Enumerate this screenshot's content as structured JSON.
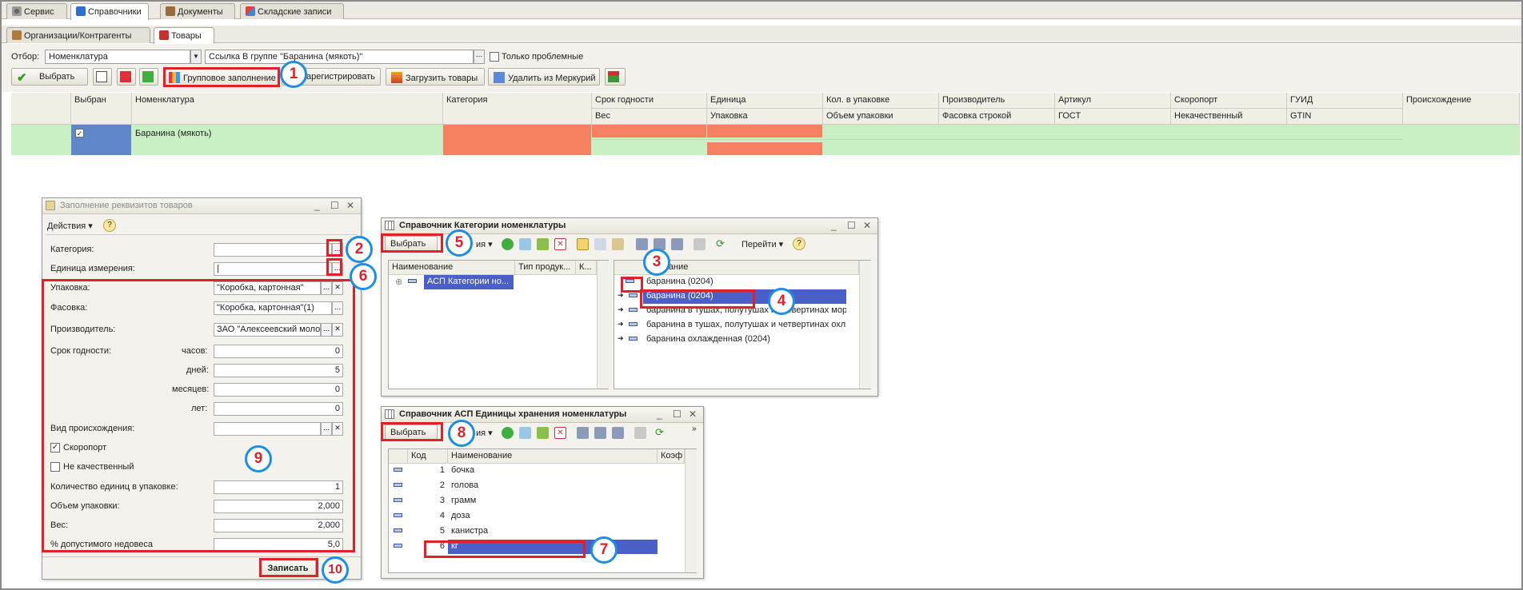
{
  "tabs_top": [
    "Сервис",
    "Справочники",
    "Документы",
    "Складские записи"
  ],
  "tabs_sub": [
    "Организации/Контрагенты",
    "Товары"
  ],
  "filter": {
    "label": "Отбор:",
    "field": "Номенклатура",
    "value": "Ссылка В группе \"Баранина (мякоть)\"",
    "only_problem": "Только проблемные"
  },
  "toolbar": {
    "select": "Выбрать",
    "group_fill": "Групповое заполнение",
    "register": "арегистрировать",
    "load": "Загрузить товары",
    "delete_mercury": "Удалить из Меркурий"
  },
  "grid": {
    "headers_top": [
      "Выбран",
      "Номенклатура",
      "Категория",
      "Срок годности",
      "Единица",
      "Кол. в упаковке",
      "Производитель",
      "Артикул",
      "Скоропорт",
      "ГУИД",
      "Происхождение"
    ],
    "headers_bottom": [
      "Вес",
      "Упаковка",
      "Объем упаковки",
      "Фасовка строкой",
      "ГОСТ",
      "Некачественный",
      "GTIN"
    ],
    "row_name": "Баранина (мякоть)",
    "row_check": "✓"
  },
  "fill_window": {
    "title": "Заполнение реквизитов товаров",
    "actions": "Действия",
    "fields": {
      "category": "Категория:",
      "unit": "Единица измерения:",
      "packing": "Упаковка:",
      "packing_value": "\"Коробка, картонная\"",
      "portion": "Фасовка:",
      "portion_value": "\"Коробка, картонная\"(1)",
      "producer": "Производитель:",
      "producer_value": "ЗАО \"Алексеевский молоч",
      "shelf": "Срок годности:",
      "hours": "часов:",
      "days": "дней:",
      "months": "месяцев:",
      "years": "лет:",
      "hours_value": "0",
      "days_value": "5",
      "months_value": "0",
      "years_value": "0",
      "origin": "Вид происхождения:",
      "perishable": "Скоропорт",
      "not_quality": "Не качественный",
      "qty_pack": "Количество единиц в упаковке:",
      "qty_pack_value": "1",
      "volume": "Объем упаковки:",
      "volume_value": "2,000",
      "weight": "Вес:",
      "weight_value": "2,000",
      "shortweight": "% допустимого недовеса",
      "shortweight_value": "5,0"
    },
    "save": "Записать"
  },
  "cat_window": {
    "title": "Справочник Категории номенклатуры",
    "select": "Выбрать",
    "actions_partial": "ия",
    "goto": "Перейти",
    "left_headers": [
      "Наименование",
      "Тип продук...",
      "К..."
    ],
    "tree_item": "АСП Категории но...",
    "right_header": "Наименование",
    "right_header_visible": "нование",
    "items": [
      "баранина (0204)",
      "баранина (0204)",
      "баранина в тушах, полутушах и четвертинах мор...",
      "баранина в тушах, полутушах и четвертинах охл...",
      "баранина охлажденная (0204)"
    ]
  },
  "unit_window": {
    "title": "Справочник АСП Единицы хранения номенклатуры",
    "select": "Выбрать",
    "actions_partial": "ия",
    "headers": [
      "Код",
      "Наименование",
      "Коэф"
    ],
    "rows": [
      {
        "code": "1",
        "name": "бочка"
      },
      {
        "code": "2",
        "name": "голова"
      },
      {
        "code": "3",
        "name": "грамм"
      },
      {
        "code": "4",
        "name": "доза"
      },
      {
        "code": "5",
        "name": "канистра"
      },
      {
        "code": "6",
        "name": "кг"
      }
    ]
  },
  "badges": [
    "1",
    "2",
    "3",
    "4",
    "5",
    "6",
    "7",
    "8",
    "9",
    "10"
  ],
  "colors": {
    "accent_red": "#e0202a",
    "badge_blue": "#1b8ee8",
    "row_green": "#c9efc4",
    "cell_orange": "#f68160",
    "selection": "#4b5fc8"
  }
}
